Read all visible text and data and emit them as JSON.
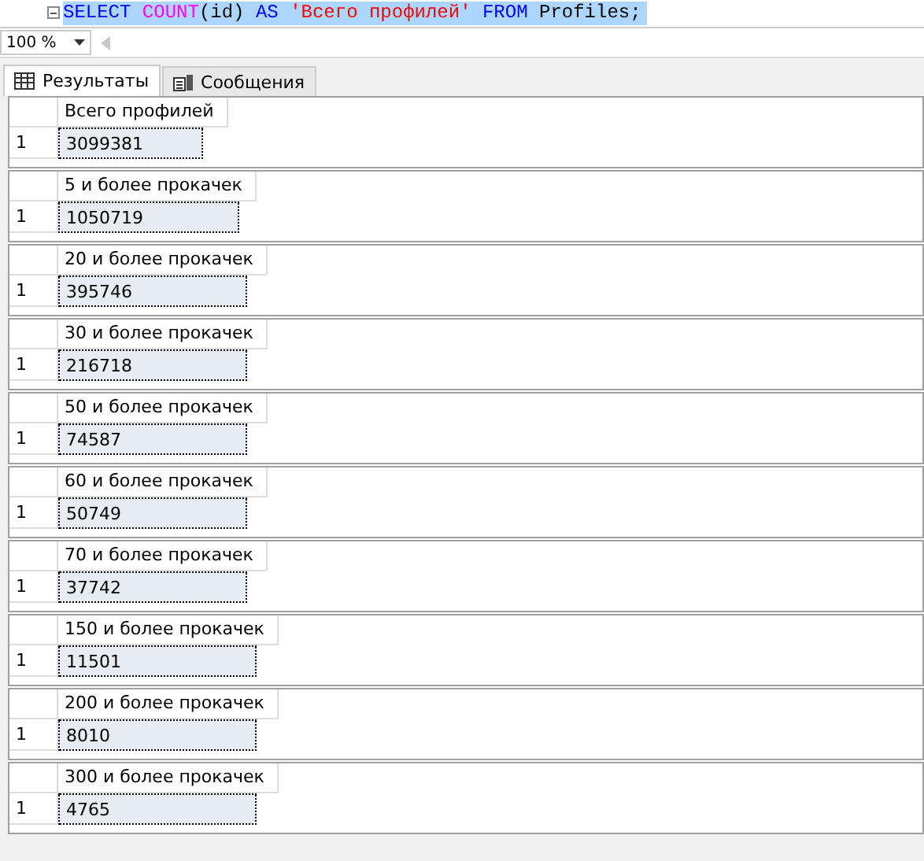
{
  "editor": {
    "tokens": [
      {
        "text": "SELECT",
        "kind": "keyword"
      },
      {
        "text": "COUNT",
        "kind": "function"
      },
      {
        "text": "(id)",
        "kind": "plain"
      },
      {
        "text": "AS",
        "kind": "keyword"
      },
      {
        "text": "'Всего профилей'",
        "kind": "string"
      },
      {
        "text": "FROM",
        "kind": "keyword"
      },
      {
        "text": "Profiles;",
        "kind": "plain"
      }
    ]
  },
  "zoom": {
    "value": "100 %"
  },
  "tabs": [
    {
      "label": "Результаты",
      "selected": true
    },
    {
      "label": "Сообщения",
      "selected": false
    }
  ],
  "results": [
    {
      "column": "Всего профилей",
      "row": "1",
      "value": "3099381",
      "selected": true
    },
    {
      "column": "5 и более прокачек",
      "row": "1",
      "value": "1050719",
      "selected": true
    },
    {
      "column": "20 и более прокачек",
      "row": "1",
      "value": "395746",
      "selected": true
    },
    {
      "column": "30 и более прокачек",
      "row": "1",
      "value": "216718",
      "selected": true
    },
    {
      "column": "50 и более прокачек",
      "row": "1",
      "value": "74587",
      "selected": true
    },
    {
      "column": "60 и более прокачек",
      "row": "1",
      "value": "50749",
      "selected": true
    },
    {
      "column": "70 и более прокачек",
      "row": "1",
      "value": "37742",
      "selected": true
    },
    {
      "column": "150 и более прокачек",
      "row": "1",
      "value": "11501",
      "selected": true
    },
    {
      "column": "200 и более прокачек",
      "row": "1",
      "value": "8010",
      "selected": true
    },
    {
      "column": "300 и более прокачек",
      "row": "1",
      "value": "4765",
      "selected": true
    }
  ]
}
